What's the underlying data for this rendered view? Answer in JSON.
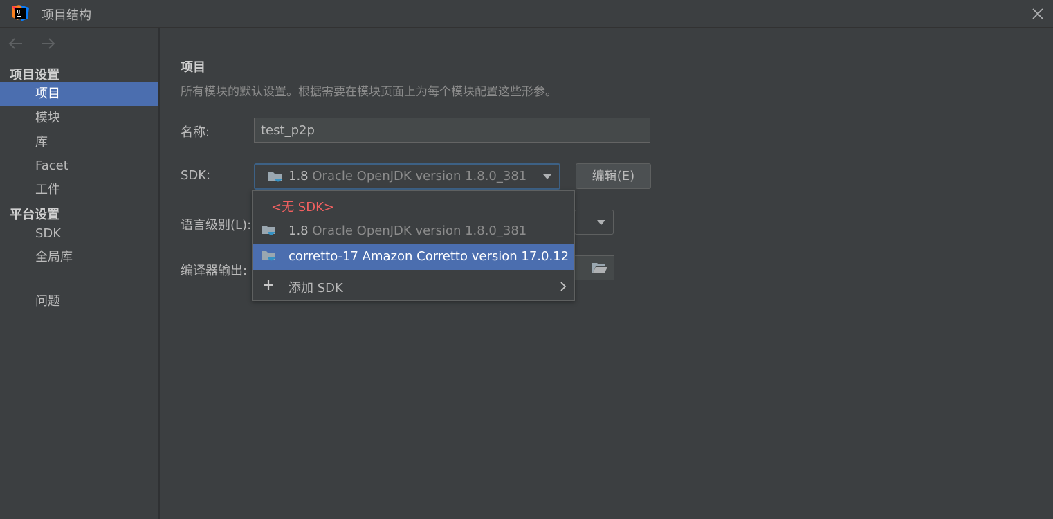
{
  "window": {
    "title": "项目结构"
  },
  "sidebar": {
    "project_settings_header": "项目设置",
    "platform_settings_header": "平台设置",
    "items": [
      {
        "label": "项目",
        "selected": true
      },
      {
        "label": "模块"
      },
      {
        "label": "库"
      },
      {
        "label": "Facet"
      },
      {
        "label": "工件"
      },
      {
        "label": "SDK"
      },
      {
        "label": "全局库"
      },
      {
        "label": "问题"
      }
    ]
  },
  "main": {
    "title": "项目",
    "description": "所有模块的默认设置。根据需要在模块页面上为每个模块配置这些形参。",
    "name_label": "名称:",
    "name_value": "test_p2p",
    "sdk_label": "SDK:",
    "sdk_selected_version": "1.8",
    "sdk_selected_desc": "Oracle OpenJDK version 1.8.0_381",
    "edit_button": "编辑(E)",
    "language_level_label": "语言级别(L):",
    "compiler_output_label": "编译器输出:"
  },
  "sdk_dropdown": {
    "items": [
      {
        "label": "<无 SDK>"
      },
      {
        "version": "1.8",
        "desc": "Oracle OpenJDK version 1.8.0_381"
      },
      {
        "label": "corretto-17 Amazon Corretto version 17.0.12",
        "selected": true
      }
    ],
    "add_sdk": "添加 SDK"
  },
  "colors": {
    "background": "#3c3f41",
    "selection": "#4b6eaf",
    "no_sdk_text": "#f16060",
    "focus_border": "#3d6185",
    "jdk_icon": "#3592c4"
  },
  "icons": [
    "intellij-logo-icon",
    "close-icon",
    "back-arrow-icon",
    "forward-arrow-icon",
    "jdk-folder-icon",
    "chevron-down-icon",
    "plus-icon",
    "chevron-right-icon",
    "folder-open-icon"
  ]
}
